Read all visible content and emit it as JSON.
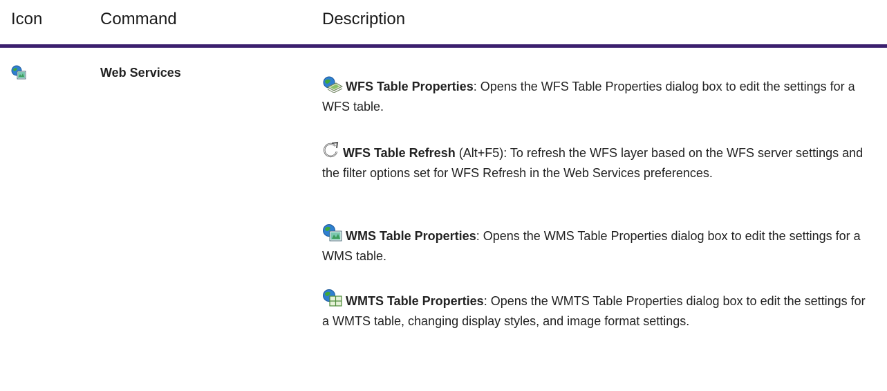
{
  "header": {
    "icon_col": "Icon",
    "command_col": "Command",
    "description_col": "Description"
  },
  "colors": {
    "rule": "#3b1f6e"
  },
  "row": {
    "icon": "web-services-globe-icon",
    "command": "Web Services",
    "items": [
      {
        "icon": "wfs-table-properties-icon",
        "name": "WFS Table Properties",
        "text": ": Opens the WFS Table Properties dialog box to edit the settings for a WFS table."
      },
      {
        "icon": "refresh-icon",
        "name": "WFS Table Refresh",
        "shortcut": " (Alt+F5)",
        "text": ": To refresh the WFS layer based on the WFS server settings and the filter options set for WFS Refresh in the Web Services preferences."
      },
      {
        "icon": "wms-table-properties-icon",
        "name": "WMS Table Properties",
        "text": ": Opens the WMS Table Properties dialog box to edit the settings for a WMS table."
      },
      {
        "icon": "wmts-table-properties-icon",
        "name": "WMTS Table Properties",
        "text": ": Opens the WMTS Table Properties dialog box to edit the settings for a WMTS table, changing display styles, and image format settings."
      }
    ]
  }
}
